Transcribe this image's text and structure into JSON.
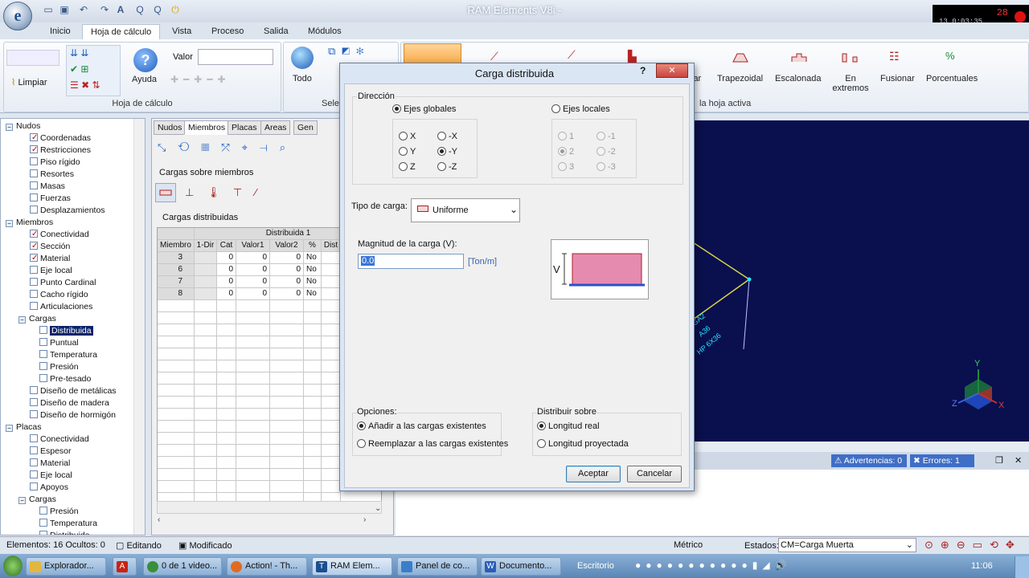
{
  "app": {
    "title": "RAM Elements V8i -",
    "logo_letter": "e"
  },
  "recorder": {
    "line1": "28",
    "line2": "13 0:03:35"
  },
  "ribbon": {
    "tabs": [
      "Inicio",
      "Hoja de cálculo",
      "Vista",
      "Proceso",
      "Salida",
      "Módulos"
    ],
    "active_tab": "Hoja de cálculo",
    "limpiar": "Limpiar",
    "ayuda": "Ayuda",
    "valor_label": "Valor",
    "todo": "Todo",
    "group_hoja": "Hoja de cálculo",
    "group_sel": "Sele",
    "group_active": "la hoja activa",
    "load_buttons": [
      "lar",
      "Trapezoidal",
      "Escalonada",
      "En extremos",
      "Fusionar",
      "Porcentuales"
    ]
  },
  "tree": {
    "items": [
      {
        "label": "Nudos",
        "level": 1,
        "type": "node"
      },
      {
        "label": "Coordenadas",
        "level": 2,
        "type": "check",
        "checked": true
      },
      {
        "label": "Restricciones",
        "level": 2,
        "type": "check",
        "checked": true
      },
      {
        "label": "Piso rígido",
        "level": 2,
        "type": "check",
        "checked": false
      },
      {
        "label": "Resortes",
        "level": 2,
        "type": "check",
        "checked": false
      },
      {
        "label": "Masas",
        "level": 2,
        "type": "check",
        "checked": false
      },
      {
        "label": "Fuerzas",
        "level": 2,
        "type": "check",
        "checked": false
      },
      {
        "label": "Desplazamientos",
        "level": 2,
        "type": "check",
        "checked": false
      },
      {
        "label": "Miembros",
        "level": 1,
        "type": "node"
      },
      {
        "label": "Conectividad",
        "level": 2,
        "type": "check",
        "checked": true
      },
      {
        "label": "Sección",
        "level": 2,
        "type": "check",
        "checked": true
      },
      {
        "label": "Material",
        "level": 2,
        "type": "check",
        "checked": true
      },
      {
        "label": "Eje local",
        "level": 2,
        "type": "check",
        "checked": false
      },
      {
        "label": "Punto Cardinal",
        "level": 2,
        "type": "check",
        "checked": false
      },
      {
        "label": "Cacho rígido",
        "level": 2,
        "type": "check",
        "checked": false
      },
      {
        "label": "Articulaciones",
        "level": 2,
        "type": "check",
        "checked": false
      },
      {
        "label": "Cargas",
        "level": 2,
        "type": "node"
      },
      {
        "label": "Distribuida",
        "level": 3,
        "type": "check",
        "checked": false,
        "selected": true
      },
      {
        "label": "Puntual",
        "level": 3,
        "type": "check",
        "checked": false
      },
      {
        "label": "Temperatura",
        "level": 3,
        "type": "check",
        "checked": false
      },
      {
        "label": "Presión",
        "level": 3,
        "type": "check",
        "checked": false
      },
      {
        "label": "Pre-tesado",
        "level": 3,
        "type": "check",
        "checked": false
      },
      {
        "label": "Diseño de metálicas",
        "level": 2,
        "type": "check",
        "checked": false
      },
      {
        "label": "Diseño de madera",
        "level": 2,
        "type": "check",
        "checked": false
      },
      {
        "label": "Diseño de hormigón",
        "level": 2,
        "type": "check",
        "checked": false
      },
      {
        "label": "Placas",
        "level": 1,
        "type": "node"
      },
      {
        "label": "Conectividad",
        "level": 2,
        "type": "check",
        "checked": false
      },
      {
        "label": "Espesor",
        "level": 2,
        "type": "check",
        "checked": false
      },
      {
        "label": "Material",
        "level": 2,
        "type": "check",
        "checked": false
      },
      {
        "label": "Eje local",
        "level": 2,
        "type": "check",
        "checked": false
      },
      {
        "label": "Apoyos",
        "level": 2,
        "type": "check",
        "checked": false
      },
      {
        "label": "Cargas",
        "level": 2,
        "type": "node"
      },
      {
        "label": "Presión",
        "level": 3,
        "type": "check",
        "checked": false
      },
      {
        "label": "Temperatura",
        "level": 3,
        "type": "check",
        "checked": false
      },
      {
        "label": "Distribuida",
        "level": 3,
        "type": "check",
        "checked": false
      }
    ]
  },
  "panel": {
    "tabs": [
      "Nudos",
      "Miembros",
      "Placas",
      "Areas",
      "Gen"
    ],
    "active_tab": "Miembros",
    "section1": "Cargas sobre miembros",
    "section2": "Cargas distribuidas",
    "grid_group": "Distribuida 1",
    "columns": [
      "Miembro",
      "1-Dir",
      "Cat",
      "Valor1",
      "Valor2",
      "%",
      "Dist"
    ],
    "rows": [
      [
        "3",
        "",
        "0",
        "0",
        "0",
        "No",
        ""
      ],
      [
        "6",
        "",
        "0",
        "0",
        "0",
        "No",
        ""
      ],
      [
        "7",
        "",
        "0",
        "0",
        "0",
        "No",
        ""
      ],
      [
        "8",
        "",
        "0",
        "0",
        "0",
        "No",
        ""
      ]
    ]
  },
  "dialog": {
    "title": "Carga distribuida",
    "help": "?",
    "close": "✕",
    "direccion": "Dirección",
    "ejes_globales": "Ejes globales",
    "ejes_locales": "Ejes locales",
    "global_axes": [
      "X",
      "-X",
      "Y",
      "-Y",
      "Z",
      "-Z"
    ],
    "global_selected": "-Y",
    "local_axes": [
      "1",
      "-1",
      "2",
      "-2",
      "3",
      "-3"
    ],
    "local_selected": "2",
    "tipo_label": "Tipo de carga:",
    "tipo_value": "Uniforme",
    "magnitud_label": "Magnitud de la carga (V):",
    "magnitud_value": "0.0",
    "magnitud_unit": "[Ton/m]",
    "diagram_label": "V",
    "opciones": "Opciones:",
    "opt_add": "Añadir a las cargas existentes",
    "opt_replace": "Reemplazar a las cargas existentes",
    "distribuir": "Distribuir sobre",
    "dist_real": "Longitud real",
    "dist_proj": "Longitud proyectada",
    "aceptar": "Aceptar",
    "cancelar": "Cancelar"
  },
  "viewport": {
    "labels": [
      "GA2",
      "A36",
      "HP 6X36"
    ],
    "axes": [
      "Y",
      "Z",
      "X"
    ]
  },
  "messages": {
    "advertencias": "Advertencias: 0",
    "errores": "Errores: 1"
  },
  "statusbar": {
    "elementos": "Elementos: 16 Ocultos: 0",
    "editando": "Editando",
    "modificado": "Modificado",
    "metrico": "Métrico",
    "estados_label": "Estados:",
    "estado_value": "CM=Carga Muerta"
  },
  "taskbar": {
    "items": [
      "Explorador...",
      "0 de 1 video...",
      "Action! - Th...",
      "RAM Elem...",
      "Panel de co...",
      "Documento..."
    ],
    "escritorio": "Escritorio",
    "clock": "11:06"
  },
  "colors": {
    "viewport_bg": "#0a0f4e",
    "load_fill": "#e58bb0",
    "load_base": "#2a4fd1",
    "accent": "#0a246a",
    "close_red": "#c9463d"
  }
}
